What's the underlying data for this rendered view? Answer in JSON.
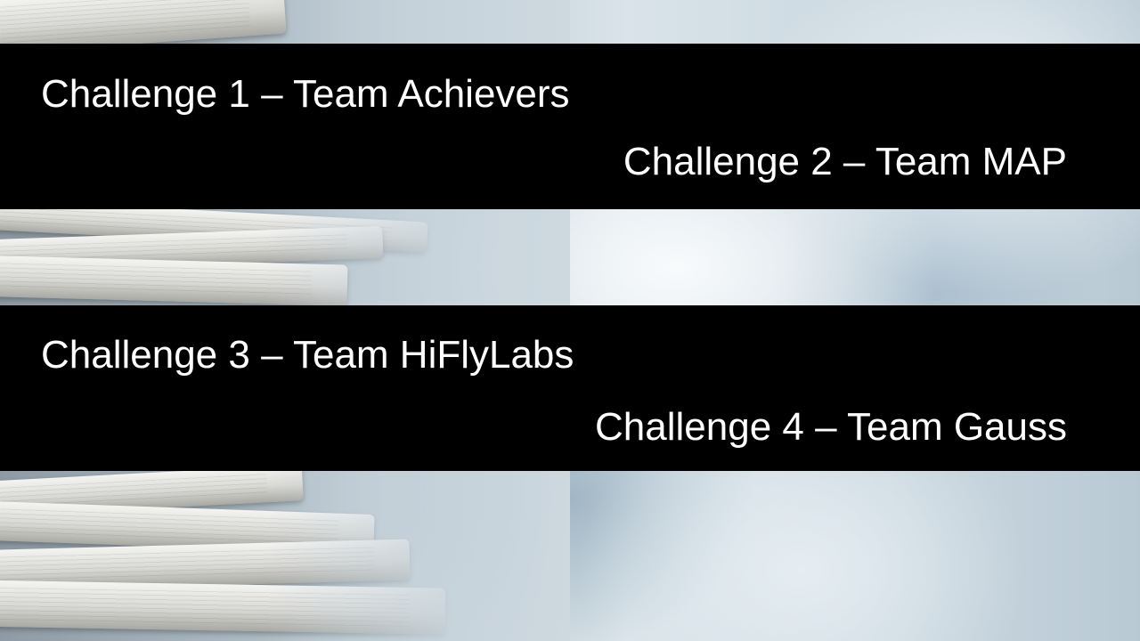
{
  "slide": {
    "challenges": [
      {
        "text": "Challenge 1 – Team Achievers"
      },
      {
        "text": "Challenge 2 – Team MAP"
      },
      {
        "text": "Challenge 3 – Team HiFlyLabs"
      },
      {
        "text": "Challenge 4 – Team Gauss"
      }
    ],
    "background_image": "newspaper-stack-image",
    "band_color": "#000000",
    "text_color": "#ffffff"
  }
}
